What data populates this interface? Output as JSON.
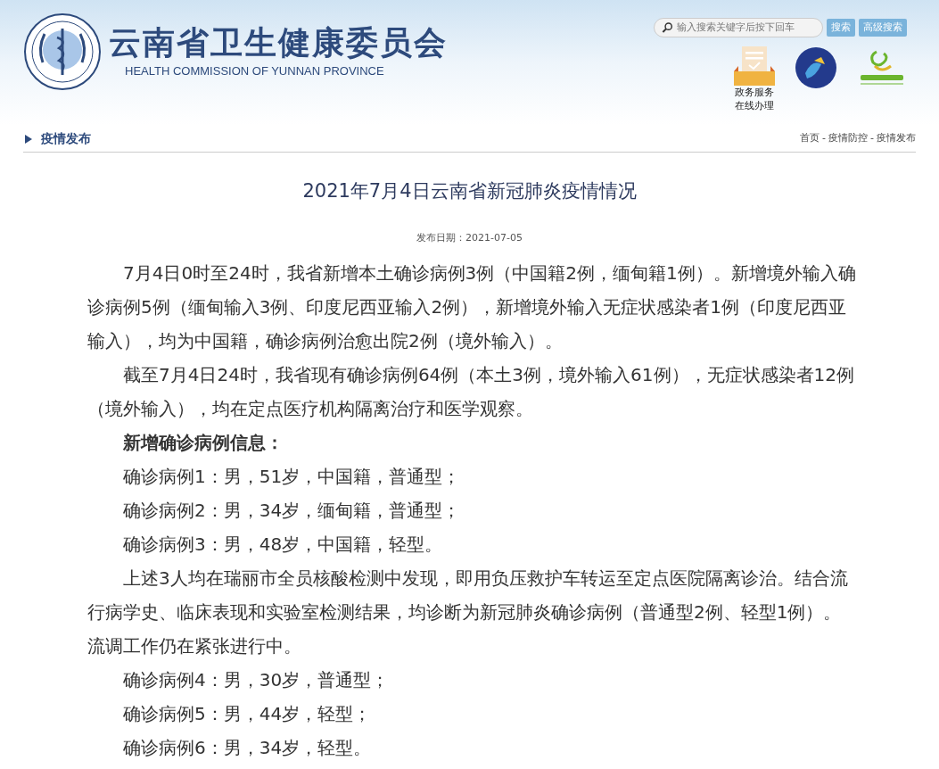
{
  "header": {
    "title": "云南省卫生健康委员会",
    "subtitle": "HEALTH COMMISSION OF YUNNAN PROVINCE",
    "search": {
      "placeholder": "输入搜索关键字后按下回车"
    },
    "buttons": [
      "搜索",
      "高级搜索"
    ],
    "service_link": {
      "lines": [
        "政务服务",
        "在线办理"
      ]
    }
  },
  "section": {
    "title": "疫情发布",
    "breadcrumb": [
      "首页",
      "疫情防控",
      "疫情发布"
    ],
    "breadcrumb_separator": "-"
  },
  "article": {
    "title": "2021年7月4日云南省新冠肺炎疫情情况",
    "date": "发布日期：2021-07-05",
    "paragraphs": [
      {
        "kind": "text",
        "text": "7月4日0时至24时，我省新增本土确诊病例3例（中国籍2例，缅甸籍1例）。新增境外输入确诊病例5例（缅甸输入3例、印度尼西亚输入2例），新增境外输入无症状感染者1例（印度尼西亚输入），均为中国籍，确诊病例治愈出院2例（境外输入）。"
      },
      {
        "kind": "text",
        "text": "截至7月4日24时，我省现有确诊病例64例（本土3例，境外输入61例），无症状感染者12例（境外输入），均在定点医疗机构隔离治疗和医学观察。"
      },
      {
        "kind": "heading",
        "text": "新增确诊病例信息："
      },
      {
        "kind": "text",
        "text": "确诊病例1：男，51岁，中国籍，普通型；"
      },
      {
        "kind": "text",
        "text": "确诊病例2：男，34岁，缅甸籍，普通型；"
      },
      {
        "kind": "text",
        "text": "确诊病例3：男，48岁，中国籍，轻型。"
      },
      {
        "kind": "text",
        "text": "上述3人均在瑞丽市全员核酸检测中发现，即用负压救护车转运至定点医院隔离诊治。结合流行病学史、临床表现和实验室检测结果，均诊断为新冠肺炎确诊病例（普通型2例、轻型1例）。流调工作仍在紧张进行中。"
      },
      {
        "kind": "text",
        "text": "确诊病例4：男，30岁，普通型；"
      },
      {
        "kind": "text",
        "text": "确诊病例5：男，44岁，轻型；"
      },
      {
        "kind": "text",
        "text": "确诊病例6：男，34岁，轻型。"
      }
    ]
  }
}
